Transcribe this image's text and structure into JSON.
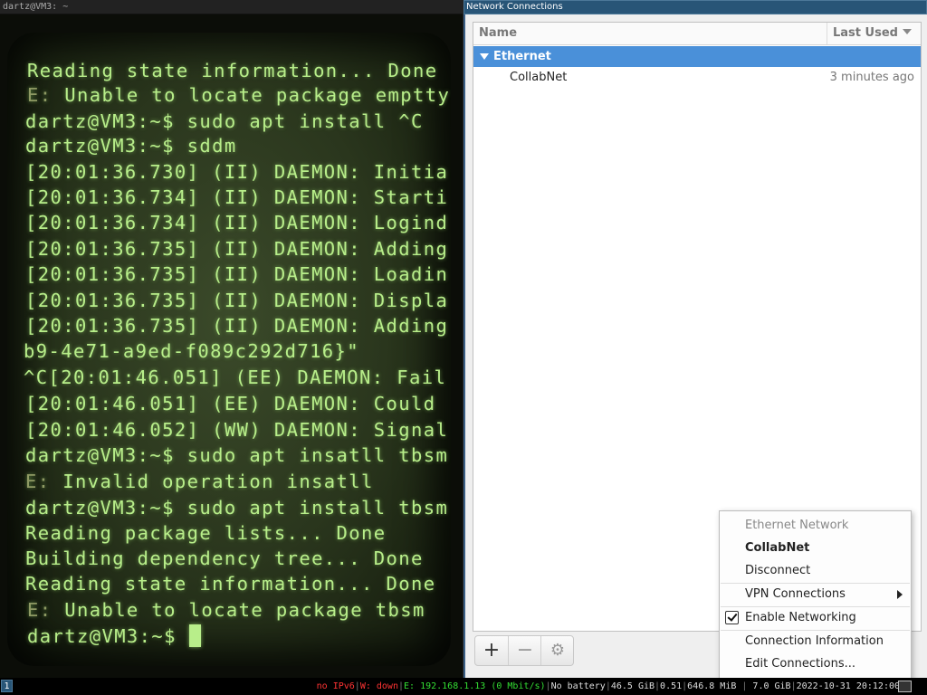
{
  "terminal": {
    "title": "dartz@VM3: ~",
    "lines": [
      {
        "prefix": "",
        "text": "Reading state information... Done"
      },
      {
        "prefix": "E:",
        "text": " Unable to locate package emptty"
      },
      {
        "prefix": "",
        "text": "dartz@VM3:~$ sudo apt install ^C"
      },
      {
        "prefix": "",
        "text": "dartz@VM3:~$ sddm"
      },
      {
        "prefix": "",
        "text": "[20:01:36.730] (II) DAEMON: Initia"
      },
      {
        "prefix": "",
        "text": "[20:01:36.734] (II) DAEMON: Starti"
      },
      {
        "prefix": "",
        "text": "[20:01:36.734] (II) DAEMON: Logind"
      },
      {
        "prefix": "",
        "text": "[20:01:36.735] (II) DAEMON: Adding"
      },
      {
        "prefix": "",
        "text": "[20:01:36.735] (II) DAEMON: Loadin"
      },
      {
        "prefix": "",
        "text": "[20:01:36.735] (II) DAEMON: Displa"
      },
      {
        "prefix": "",
        "text": "[20:01:36.735] (II) DAEMON: Adding"
      },
      {
        "prefix": "",
        "text": "b9-4e71-a9ed-f089c292d716}\""
      },
      {
        "prefix": "",
        "text": "^C[20:01:46.051] (EE) DAEMON: Fail"
      },
      {
        "prefix": "",
        "text": "[20:01:46.051] (EE) DAEMON: Could"
      },
      {
        "prefix": "",
        "text": "[20:01:46.052] (WW) DAEMON: Signal"
      },
      {
        "prefix": "",
        "text": "dartz@VM3:~$ sudo apt insatll tbsm"
      },
      {
        "prefix": "E:",
        "text": " Invalid operation insatll"
      },
      {
        "prefix": "",
        "text": "dartz@VM3:~$ sudo apt install tbsm"
      },
      {
        "prefix": "",
        "text": "Reading package lists... Done"
      },
      {
        "prefix": "",
        "text": "Building dependency tree... Done"
      },
      {
        "prefix": "",
        "text": "Reading state information... Done"
      },
      {
        "prefix": "E:",
        "text": " Unable to locate package tbsm"
      },
      {
        "prefix": "",
        "text": "dartz@VM3:~$ "
      }
    ]
  },
  "network": {
    "title": "Network Connections",
    "columns": {
      "name": "Name",
      "last_used": "Last Used"
    },
    "group": "Ethernet",
    "connection": {
      "name": "CollabNet",
      "last_used": "3 minutes ago"
    },
    "toolbar": {
      "add": "+",
      "remove": "−",
      "settings": "⚙"
    }
  },
  "menu": {
    "header": "Ethernet Network",
    "active": "CollabNet",
    "disconnect": "Disconnect",
    "vpn": "VPN Connections",
    "enable": "Enable Networking",
    "enable_checked": true,
    "info": "Connection Information",
    "edit": "Edit Connections..."
  },
  "statusbar": {
    "workspace": "1",
    "ipv6": "no IPv6",
    "wifi": "W: down",
    "eth": "E: 192.168.1.13 (0 Mbit/s)",
    "battery": "No battery",
    "disk": "46.5 GiB",
    "load": "0.51",
    "mem": "646.8 MiB",
    "mem_total": "7.0 GiB",
    "datetime": "2022-10-31 20:12:00"
  },
  "colors": {
    "terminal_text": "#b8ee8a",
    "selection": "#4a90d9",
    "titlebar_active": "#285577"
  }
}
